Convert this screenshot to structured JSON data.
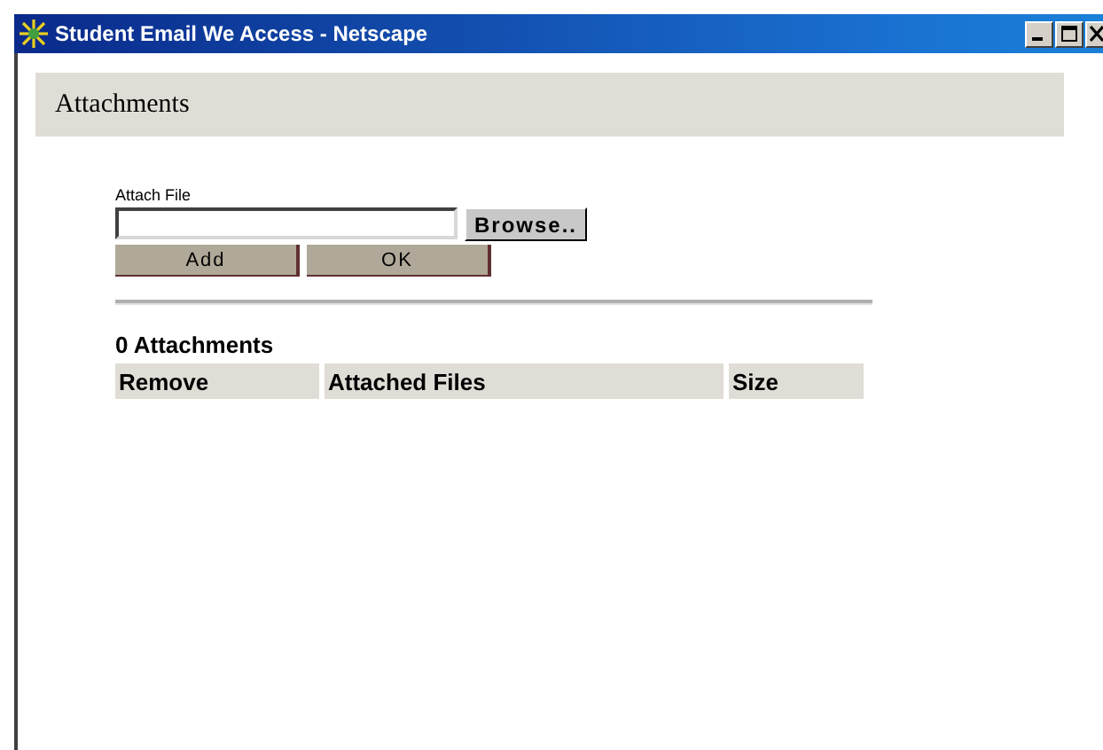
{
  "window": {
    "title": "Student Email We Access - Netscape"
  },
  "header": {
    "title": "Attachments"
  },
  "form": {
    "label": "Attach File",
    "browse_button": "Browse..",
    "buttons": [
      "Add",
      "OK"
    ]
  },
  "attachments": {
    "count_label": "0 Attachments",
    "columns": [
      "Remove",
      "Attached Files",
      "Size"
    ]
  }
}
